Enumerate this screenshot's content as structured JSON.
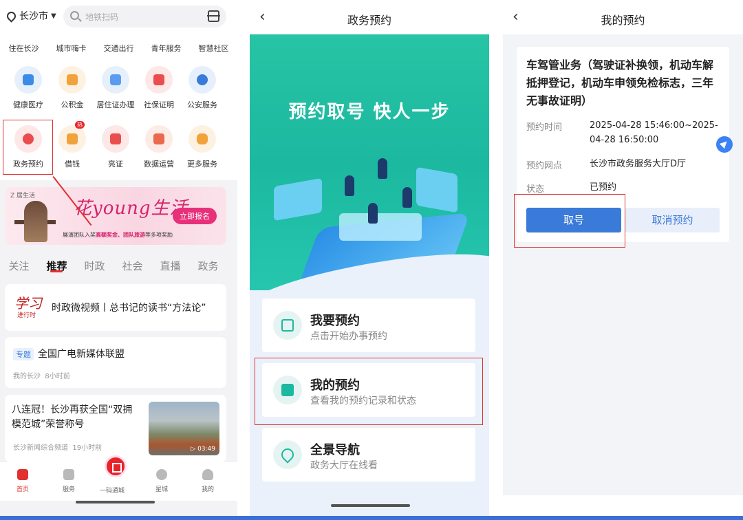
{
  "panel1": {
    "city": "长沙市",
    "search_placeholder": "地铁扫码",
    "top_links": [
      "住在长沙",
      "城市嗨卡",
      "交通出行",
      "青年服务",
      "智慧社区"
    ],
    "services_row1": [
      {
        "label": "健康医疗",
        "icon": "medical-kit-icon",
        "color": "#3b8ce6"
      },
      {
        "label": "公积金",
        "icon": "fund-icon",
        "color": "#f2a23a"
      },
      {
        "label": "居住证办理",
        "icon": "house-icon",
        "color": "#5b9cf0"
      },
      {
        "label": "社保证明",
        "icon": "shield-search-icon",
        "color": "#ea4d4d"
      },
      {
        "label": "公安服务",
        "icon": "police-badge-icon",
        "color": "#3a7ad8"
      }
    ],
    "services_row2": [
      {
        "label": "政务预约",
        "icon": "clock-icon",
        "color": "#ea4d4d"
      },
      {
        "label": "借钱",
        "icon": "wallet-icon",
        "color": "#f2a23a",
        "badge": "热"
      },
      {
        "label": "亮证",
        "icon": "id-card-icon",
        "color": "#ea4d4d"
      },
      {
        "label": "数据运营",
        "icon": "data-shield-icon",
        "color": "#ea6a4d"
      },
      {
        "label": "更多服务",
        "icon": "grid-more-icon",
        "color": "#f2a23a"
      }
    ],
    "banner": {
      "brand": "Z 居生活",
      "script": "花young生活",
      "button": "立即报名",
      "sub_prefix": "展演团队入奖",
      "sub_highlight": "高额奖金、团队旅游",
      "sub_suffix": "等多项奖励"
    },
    "tabs": [
      "关注",
      "推荐",
      "时政",
      "社会",
      "直播",
      "政务"
    ],
    "active_tab": "推荐",
    "news": {
      "card1": {
        "logo": "学习",
        "logo_sub": "进行时",
        "text": "时政微视频丨总书记的读书“方法论”"
      },
      "card2": {
        "tag": "专题",
        "title": "全国广电新媒体联盟",
        "source": "我的长沙",
        "time": "8小时前"
      },
      "card3": {
        "title": "八连冠！长沙再获全国“双拥模范城”荣誉称号",
        "source": "长沙新闻综合频道",
        "time": "19小时前",
        "duration": "03:49"
      }
    },
    "tabbar": [
      "首页",
      "服务",
      "一码通城",
      "星城",
      "我的"
    ]
  },
  "panel2": {
    "title": "政务预约",
    "slogan": "预约取号 快人一步",
    "menu": [
      {
        "title": "我要预约",
        "subtitle": "点击开始办事预约"
      },
      {
        "title": "我的预约",
        "subtitle": "查看我的预约记录和状态"
      },
      {
        "title": "全景导航",
        "subtitle": "政务大厅在线看"
      }
    ]
  },
  "panel3": {
    "title": "我的预约",
    "appointment_title": "车驾管业务（驾驶证补换领，机动车解抵押登记，机动车申领免检标志，三年无事故证明）",
    "time_label": "预约时间",
    "time_value": "2025-04-28 15:46:00~2025-04-28 16:50:00",
    "location_label": "预约网点",
    "location_value": "长沙市政务服务大厅D厅",
    "status_label": "状态",
    "status_value": "已预约",
    "primary_button": "取号",
    "secondary_button": "取消预约"
  },
  "colors": {
    "accent_red": "#e03030",
    "brand_blue": "#3a7ad8",
    "hero_green": "#1cb8a0"
  }
}
